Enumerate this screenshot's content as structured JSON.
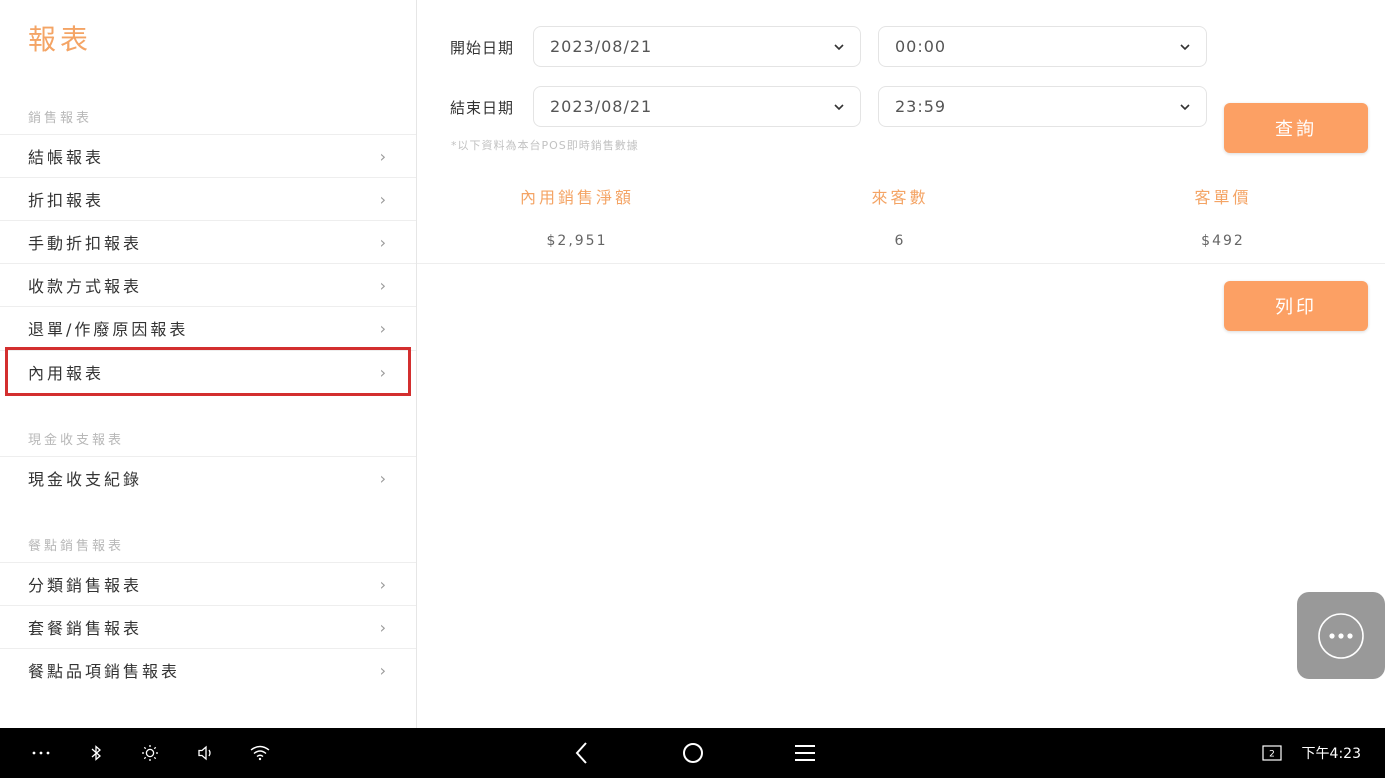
{
  "sidebar": {
    "title": "報表",
    "sections": [
      {
        "label": "銷售報表",
        "items": [
          {
            "label": "結帳報表"
          },
          {
            "label": "折扣報表"
          },
          {
            "label": "手動折扣報表"
          },
          {
            "label": "收款方式報表"
          },
          {
            "label": "退單/作廢原因報表"
          },
          {
            "label": "內用報表"
          }
        ]
      },
      {
        "label": "現金收支報表",
        "items": [
          {
            "label": "現金收支紀錄"
          }
        ]
      },
      {
        "label": "餐點銷售報表",
        "items": [
          {
            "label": "分類銷售報表"
          },
          {
            "label": "套餐銷售報表"
          },
          {
            "label": "餐點品項銷售報表"
          }
        ]
      }
    ],
    "chevron": "›"
  },
  "filters": {
    "start_label": "開始日期",
    "start_date": "2023/08/21",
    "start_time": "00:00",
    "end_label": "結束日期",
    "end_date": "2023/08/21",
    "end_time": "23:59",
    "note": "*以下資料為本台POS即時銷售數據"
  },
  "buttons": {
    "query": "查詢",
    "print": "列印"
  },
  "stats": {
    "headers": [
      "內用銷售淨額",
      "來客數",
      "客單價"
    ],
    "values": [
      "$2,951",
      "6",
      "$492"
    ]
  },
  "system_bar": {
    "time": "下午4:23",
    "badge": "2"
  },
  "colors": {
    "accent": "#fca064",
    "accent_text": "#f4a465",
    "highlight": "#d32f2f"
  }
}
